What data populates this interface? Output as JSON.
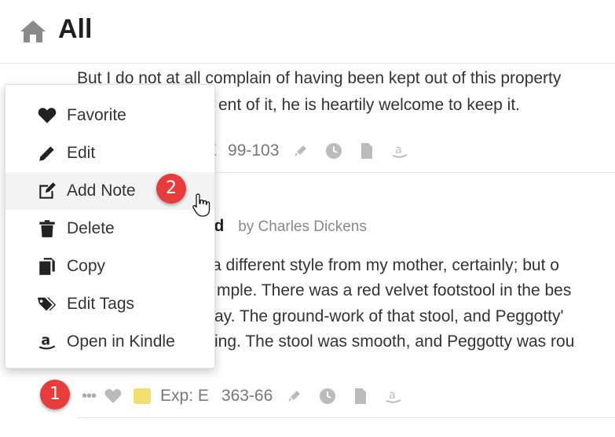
{
  "header": {
    "title": "All"
  },
  "note1": {
    "line1": "But I do not at all complain of having been kept out of this property",
    "line2": "ent of it, he is heartily welcome to keep it.",
    "location_partial": "E",
    "location": "99-103"
  },
  "note2": {
    "book_title_partial": "eld",
    "author": "by Charles Dickens",
    "lines": [
      "a different style from my mother, certainly; but o",
      "mple. There was a red velvet footstool in the bes",
      "ay. The ground-work of that stool, and Peggotty'",
      "ing. The stool was smooth, and Peggotty was rou"
    ],
    "more_glyph": "•••",
    "exp_label": "Exp: E",
    "location": "363-66",
    "highlight_color": "#f1e06d"
  },
  "menu": {
    "items": [
      {
        "label": "Favorite",
        "icon": "heart-icon"
      },
      {
        "label": "Edit",
        "icon": "pencil-icon"
      },
      {
        "label": "Add Note",
        "icon": "edit-note-icon"
      },
      {
        "label": "Delete",
        "icon": "trash-icon"
      },
      {
        "label": "Copy",
        "icon": "copy-icon"
      },
      {
        "label": "Edit Tags",
        "icon": "tags-icon"
      },
      {
        "label": "Open in Kindle",
        "icon": "amazon-icon"
      }
    ]
  },
  "annotations": {
    "badge1": "1",
    "badge2": "2",
    "badge_color": "#e83b3b"
  }
}
